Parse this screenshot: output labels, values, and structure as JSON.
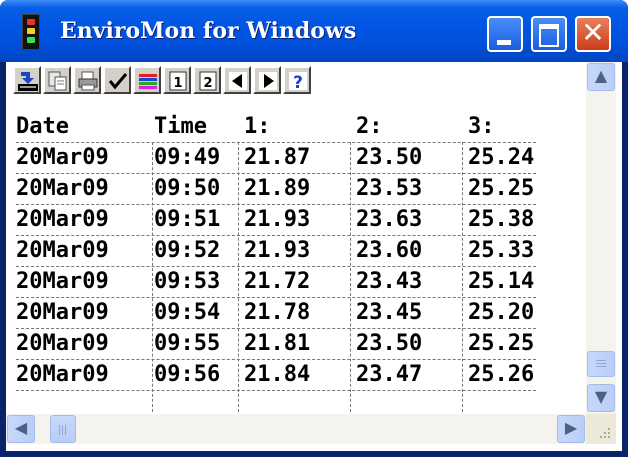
{
  "window": {
    "title": "EnviroMon for Windows"
  },
  "title_buttons": {
    "close_glyph": "✕"
  },
  "toolbar": {
    "buttons": [
      {
        "icon": "import-icon"
      },
      {
        "icon": "copy-icon"
      },
      {
        "icon": "print-icon"
      },
      {
        "icon": "checkmark-icon"
      },
      {
        "icon": "color-lines-icon"
      },
      {
        "icon": "page-1-icon",
        "glyph": "1"
      },
      {
        "icon": "page-2-icon",
        "glyph": "2"
      },
      {
        "icon": "previous-icon"
      },
      {
        "icon": "next-icon"
      },
      {
        "icon": "help-icon",
        "glyph": "?"
      }
    ]
  },
  "table": {
    "headers": [
      "Date",
      "Time",
      "1:",
      "2:",
      "3:"
    ],
    "rows": [
      [
        "20Mar09",
        "09:49",
        "21.87",
        "23.50",
        "25.24"
      ],
      [
        "20Mar09",
        "09:50",
        "21.89",
        "23.53",
        "25.25"
      ],
      [
        "20Mar09",
        "09:51",
        "21.93",
        "23.63",
        "25.38"
      ],
      [
        "20Mar09",
        "09:52",
        "21.93",
        "23.60",
        "25.33"
      ],
      [
        "20Mar09",
        "09:53",
        "21.72",
        "23.43",
        "25.14"
      ],
      [
        "20Mar09",
        "09:54",
        "21.78",
        "23.45",
        "25.20"
      ],
      [
        "20Mar09",
        "09:55",
        "21.81",
        "23.50",
        "25.25"
      ],
      [
        "20Mar09",
        "09:56",
        "21.84",
        "23.47",
        "25.26"
      ]
    ]
  },
  "scrollbars": {
    "up": "▲",
    "down": "▼",
    "left": "◀",
    "right": "▶"
  },
  "colors": {
    "titlebar": "#0054e3",
    "close_button": "#cc3c18",
    "toolbar_face": "#d4d0c8",
    "scrollbar_button": "#c1d3fb"
  }
}
